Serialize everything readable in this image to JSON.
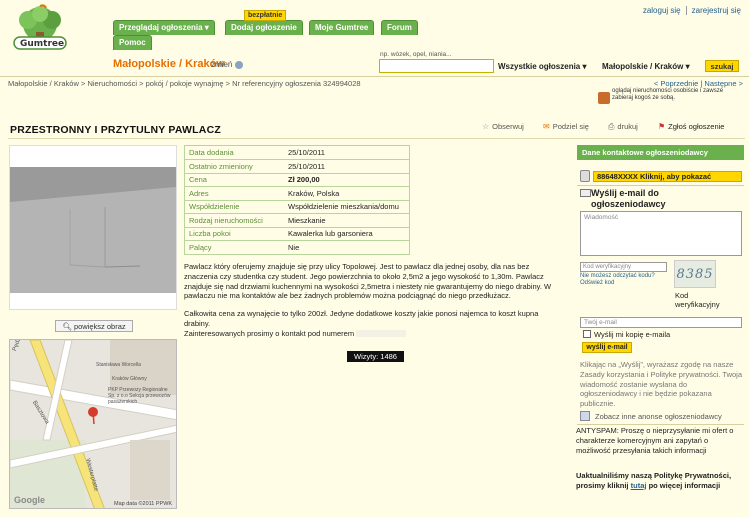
{
  "brand": {
    "logo_text": "Gumtree"
  },
  "nav": {
    "tabs": [
      {
        "label": "Przeglądaj ogłoszenia ▾"
      },
      {
        "label": "Dodaj ogłoszenie"
      },
      {
        "label": "Moje Gumtree"
      },
      {
        "label": "Forum"
      },
      {
        "label": "Pomoc"
      }
    ],
    "free_badge": "bezpłatnie"
  },
  "user_links": {
    "login": "zaloguj się",
    "register": "zarejestruj się"
  },
  "location": {
    "title": "Małopolskie / Kraków",
    "change": "zmień"
  },
  "search": {
    "hint": "np. wózek, opel, niania...",
    "input_value": "",
    "category": "Wszystkie ogłoszenia",
    "location": "Małopolskie / Kraków",
    "button": "szukaj"
  },
  "breadcrumb": {
    "items": [
      "Małopolskie / Kraków",
      "Nieruchomości",
      "pokój / pokoje wynajmę"
    ],
    "current": "Nr referencyjny ogłoszenia 324994028"
  },
  "pager": {
    "prev": "< Poprzednie",
    "next": "Następne >"
  },
  "notice": "oglądaj nieruchomości osobiście i zawsze zabieraj kogoś ze sobą.",
  "ad": {
    "title": "PRZESTRONNY I PRZYTULNY PAWLACZ",
    "actions": {
      "watch": "Obserwuj",
      "share": "Podziel się",
      "print": "drukuj",
      "report": "Zgłoś ogłoszenie"
    },
    "enlarge": "powiększ obraz",
    "details": [
      {
        "key": "Data dodania",
        "value": "25/10/2011"
      },
      {
        "key": "Ostatnio zmieniony",
        "value": "25/10/2011"
      },
      {
        "key": "Cena",
        "value": "Zł  200,00"
      },
      {
        "key": "Adres",
        "value": "Kraków, Polska"
      },
      {
        "key": "Współdzielenie",
        "value": "Współdzielenie mieszkania/domu"
      },
      {
        "key": "Rodzaj nieruchomości",
        "value": "Mieszkanie"
      },
      {
        "key": "Liczba pokoi",
        "value": "Kawalerka lub garsoniera"
      },
      {
        "key": "Palący",
        "value": "Nie"
      }
    ],
    "description": [
      "Pawlacz który oferujemy znajduje się przy ulicy Topolowej. Jest to pawlacz dla jednej osoby, dla nas bez znaczenia czy studentka czy student. Jego powierzchnia to około 2,5m2 a jego wysokość to 1,30m. Pawlacz znajduje się nad drzwiami kuchennymi na wysokości 2,5metra i niestety nie gwarantujemy do niego drabiny. W pawlaczu nie ma kontaktów ale bez żadnych problemów można podciągnąć do niego przedłużacz.",
      "Całkowita cena za wynajęcie to tylko 200zł. Jedyne dodatkowe koszty jakie ponosi najemca to koszt kupna drabiny."
    ],
    "contact_line": "Zainteresowanych prosimy o kontakt pod numerem",
    "views": "Wizyty: 1486"
  },
  "map": {
    "streets": [
      "Pędzichów",
      "Stanisława Worcella",
      "Basztowa",
      "Westerplatte"
    ],
    "poi": [
      "Kraków Główny",
      "PKP Przewozy Regionalne Sp. z o.o Sekcja przewozów pasażerskich"
    ],
    "brand": "Google",
    "copyright": "Map data ©2011 PPWK"
  },
  "sidebar": {
    "contact_head": "Dane kontaktowe ogłoszeniodawcy",
    "phone_button": "88648XXXX   Kliknij, aby pokazać",
    "mail_title": "Wyślij e-mail do ogłoszeniodawcy",
    "message_placeholder": "Wiadomość",
    "captcha_placeholder": "Kod weryfikacyjny",
    "captcha_hint": "Nie możesz odczytać kodu? Odśwież kod",
    "captcha_code": "8385",
    "captcha_caption": "Kod weryfikacyjny",
    "email_placeholder": "Twój e-mail",
    "copy_label": "Wyślij mi kopię e-maila",
    "send_button": "wyślij e-mail",
    "terms": "Klikając na „Wyślij”, wyrażasz zgodę na nasze Zasady korzystania i Polityke prywatności. Twoja wiadomość zostanie wysłana do ogłoszeniodawcy i nie będzie pokazana publicznie.",
    "other_ads": "Zobacz inne anonse ogłoszeniodawcy",
    "antyspam": "ANTYSPAM: Proszę o nieprzysyłanie mi ofert o charakterze komercyjnym ani zapytań o możliwość przesyłania takich informacji",
    "privacy_text": "Uaktualniliśmy naszą Politykę Prywatności, prosimy kliknij",
    "privacy_link": "tutaj",
    "privacy_tail": "po więcej informacji"
  },
  "colors": {
    "accent_green": "#6ab04c",
    "accent_orange": "#e66f00",
    "button_yellow": "#ffd600",
    "background": "#fffde6"
  }
}
